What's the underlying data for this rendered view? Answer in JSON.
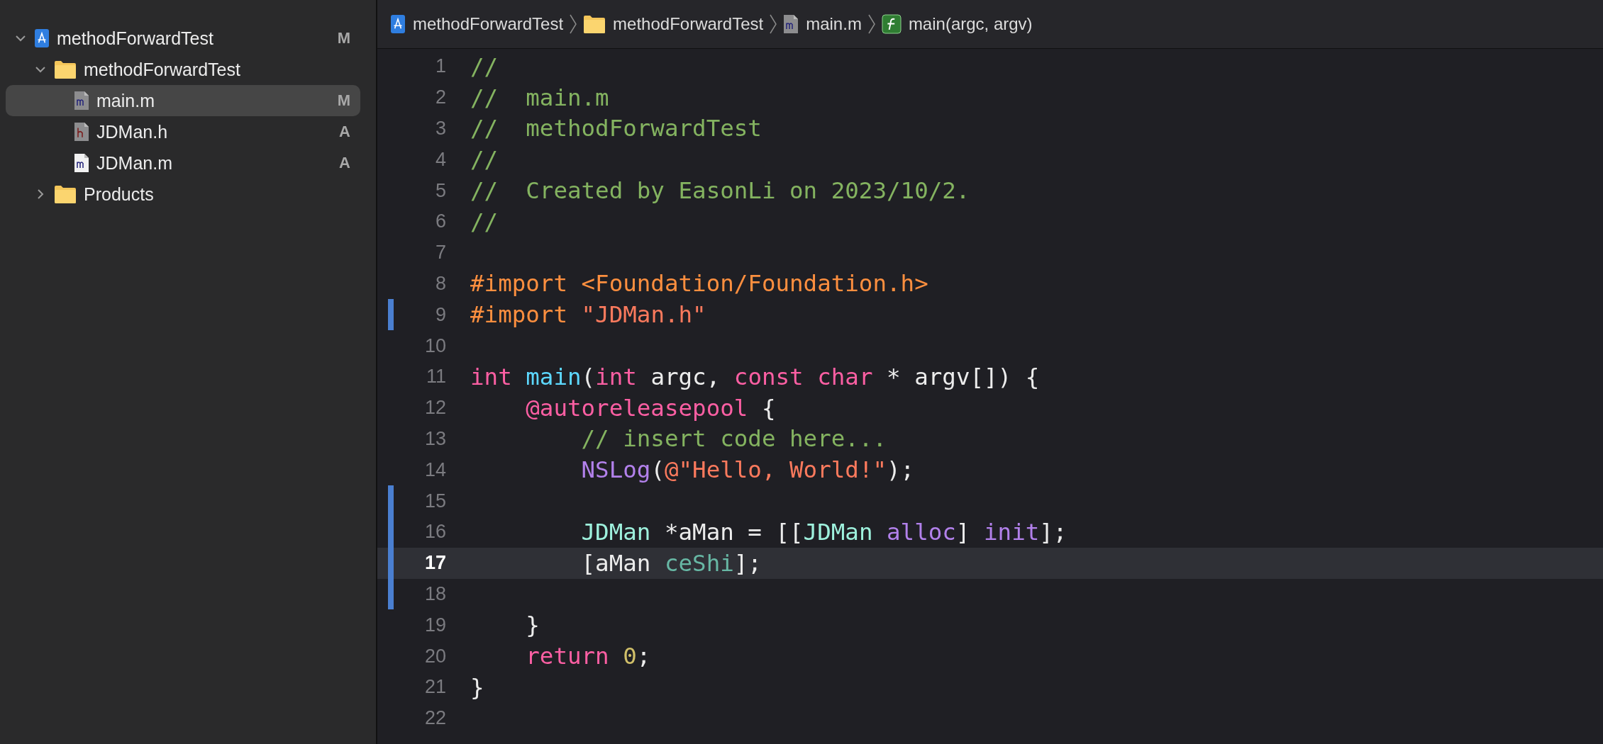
{
  "navigator": {
    "items": [
      {
        "name": "methodForwardTest",
        "kind": "project",
        "status": "M",
        "selected": false,
        "expanded": true,
        "children": [
          {
            "name": "methodForwardTest",
            "kind": "folder",
            "expanded": true,
            "selected": false,
            "children": [
              {
                "name": "main.m",
                "kind": "source",
                "status": "M",
                "selected": true
              },
              {
                "name": "JDMan.h",
                "kind": "header",
                "status": "A",
                "selected": false
              },
              {
                "name": "JDMan.m",
                "kind": "source-new",
                "status": "A",
                "selected": false
              }
            ]
          },
          {
            "name": "Products",
            "kind": "folder",
            "expanded": false,
            "selected": false
          }
        ]
      }
    ]
  },
  "breadcrumb": [
    {
      "kind": "project",
      "label": "methodForwardTest"
    },
    {
      "kind": "folder",
      "label": "methodForwardTest"
    },
    {
      "kind": "source",
      "label": "main.m"
    },
    {
      "kind": "function",
      "label": "main(argc, argv)"
    }
  ],
  "editor": {
    "lines": [
      {
        "number": "1",
        "current": false,
        "changed": false,
        "tokens": [
          {
            "kind": "comment",
            "text": "//"
          }
        ]
      },
      {
        "number": "2",
        "current": false,
        "changed": false,
        "tokens": [
          {
            "kind": "comment",
            "text": "//  main.m"
          }
        ]
      },
      {
        "number": "3",
        "current": false,
        "changed": false,
        "tokens": [
          {
            "kind": "comment",
            "text": "//  methodForwardTest"
          }
        ]
      },
      {
        "number": "4",
        "current": false,
        "changed": false,
        "tokens": [
          {
            "kind": "comment",
            "text": "//"
          }
        ]
      },
      {
        "number": "5",
        "current": false,
        "changed": false,
        "tokens": [
          {
            "kind": "comment",
            "text": "//  Created by EasonLi on 2023/10/2."
          }
        ]
      },
      {
        "number": "6",
        "current": false,
        "changed": false,
        "tokens": [
          {
            "kind": "comment",
            "text": "//"
          }
        ]
      },
      {
        "number": "7",
        "current": false,
        "changed": false
      },
      {
        "number": "8",
        "current": false,
        "changed": false,
        "tokens": [
          {
            "kind": "preproc",
            "text": "#import <Foundation/Foundation.h>"
          }
        ]
      },
      {
        "number": "9",
        "current": false,
        "changed": true,
        "tokens": [
          {
            "kind": "preproc",
            "text": "#import "
          },
          {
            "kind": "string",
            "text": "\"JDMan.h\""
          }
        ]
      },
      {
        "number": "10",
        "current": false,
        "changed": false
      },
      {
        "number": "11",
        "current": false,
        "changed": false,
        "tokens": [
          {
            "kind": "keyword",
            "text": "int "
          },
          {
            "kind": "declaration",
            "text": "main"
          },
          {
            "kind": "plain",
            "text": "("
          },
          {
            "kind": "keyword",
            "text": "int"
          },
          {
            "kind": "plain",
            "text": " argc, "
          },
          {
            "kind": "keyword",
            "text": "const "
          },
          {
            "kind": "keyword",
            "text": "char"
          },
          {
            "kind": "plain",
            "text": " * argv[]) {"
          }
        ]
      },
      {
        "number": "12",
        "current": false,
        "changed": false,
        "tokens": [
          {
            "kind": "keyword",
            "text": "    @autoreleasepool"
          },
          {
            "kind": "plain",
            "text": " {"
          }
        ]
      },
      {
        "number": "13",
        "current": false,
        "changed": false,
        "tokens": [
          {
            "kind": "comment",
            "text": "        // insert code here..."
          }
        ]
      },
      {
        "number": "14",
        "current": false,
        "changed": false,
        "tokens": [
          {
            "kind": "function",
            "text": "        NSLog"
          },
          {
            "kind": "plain",
            "text": "("
          },
          {
            "kind": "string",
            "text": "@\"Hello, World!\""
          },
          {
            "kind": "plain",
            "text": ");"
          }
        ]
      },
      {
        "number": "15",
        "current": false,
        "changed": true
      },
      {
        "number": "16",
        "current": false,
        "changed": true,
        "tokens": [
          {
            "kind": "class",
            "text": "        JDMan"
          },
          {
            "kind": "plain",
            "text": " *aMan = [["
          },
          {
            "kind": "class",
            "text": "JDMan "
          },
          {
            "kind": "method",
            "text": "alloc"
          },
          {
            "kind": "plain",
            "text": "] "
          },
          {
            "kind": "method",
            "text": "init"
          },
          {
            "kind": "plain",
            "text": "];"
          }
        ]
      },
      {
        "number": "17",
        "current": true,
        "changed": true,
        "tokens": [
          {
            "kind": "plain",
            "text": "        [aMan "
          },
          {
            "kind": "project-method",
            "text": "ceShi"
          },
          {
            "kind": "plain",
            "text": "];"
          }
        ]
      },
      {
        "number": "18",
        "current": false,
        "changed": true
      },
      {
        "number": "19",
        "current": false,
        "changed": false,
        "tokens": [
          {
            "kind": "plain",
            "text": "    }"
          }
        ]
      },
      {
        "number": "20",
        "current": false,
        "changed": false,
        "tokens": [
          {
            "kind": "keyword",
            "text": "    return "
          },
          {
            "kind": "number",
            "text": "0"
          },
          {
            "kind": "plain",
            "text": ";"
          }
        ]
      },
      {
        "number": "21",
        "current": false,
        "changed": false,
        "tokens": [
          {
            "kind": "plain",
            "text": "}"
          }
        ]
      },
      {
        "number": "22",
        "current": false,
        "changed": false
      }
    ]
  }
}
